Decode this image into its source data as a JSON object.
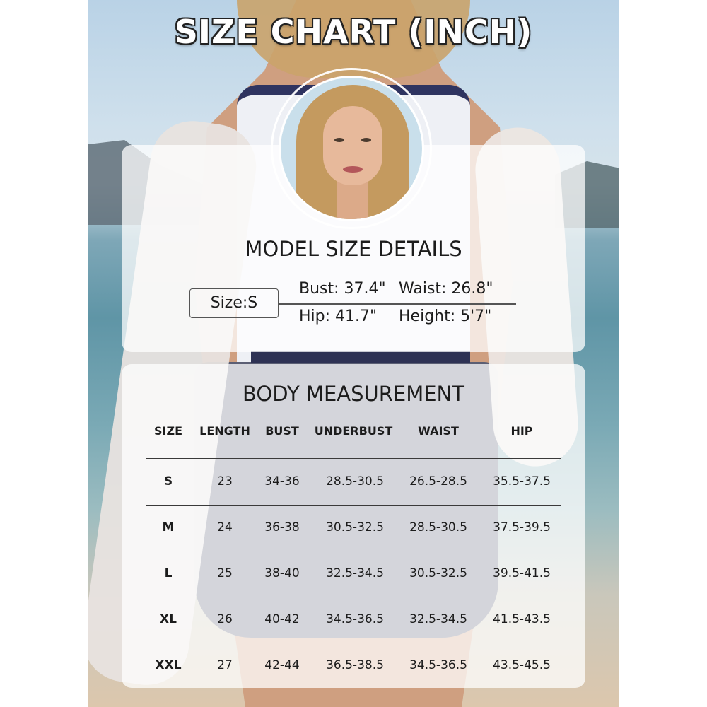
{
  "title": "SIZE CHART (INCH)",
  "model": {
    "heading": "MODEL SIZE DETAILS",
    "size": "Size:S",
    "bust": "Bust: 37.4\"",
    "waist": "Waist: 26.8\"",
    "hip": "Hip: 41.7\"",
    "height": "Height: 5'7\""
  },
  "body_measurement": {
    "heading": "BODY MEASUREMENT",
    "columns": [
      "SIZE",
      "LENGTH",
      "BUST",
      "UNDERBUST",
      "WAIST",
      "HIP"
    ],
    "rows": [
      [
        "S",
        "23",
        "34-36",
        "28.5-30.5",
        "26.5-28.5",
        "35.5-37.5"
      ],
      [
        "M",
        "24",
        "36-38",
        "30.5-32.5",
        "28.5-30.5",
        "37.5-39.5"
      ],
      [
        "L",
        "25",
        "38-40",
        "32.5-34.5",
        "30.5-32.5",
        "39.5-41.5"
      ],
      [
        "XL",
        "26",
        "40-42",
        "34.5-36.5",
        "32.5-34.5",
        "41.5-43.5"
      ],
      [
        "XXL",
        "27",
        "42-44",
        "36.5-38.5",
        "34.5-36.5",
        "43.5-45.5"
      ]
    ]
  }
}
